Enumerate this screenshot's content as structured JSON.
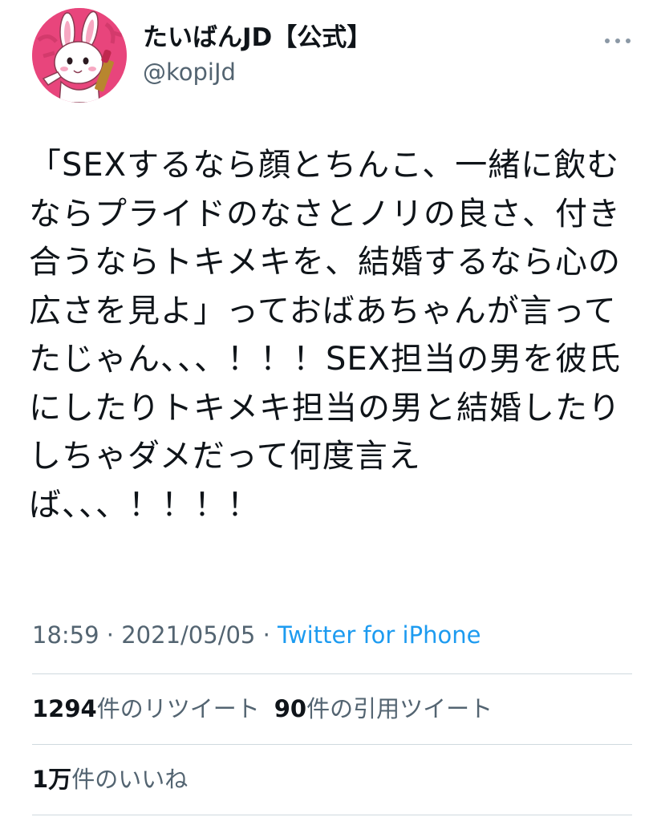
{
  "user": {
    "display_name": "たいばんJD【公式】",
    "handle": "@kopiJd",
    "avatar_icon": "rabbit-mascot-avatar-icon"
  },
  "tweet": {
    "text": "「SEXするなら顔とちんこ、一緒に飲むならプライドのなさとノリの良さ、付き合うならトキメキを、結婚するなら心の広さを見よ」っておばあちゃんが言ってたじゃん、、、！！！SEX担当の男を彼氏にしたりトキメキ担当の男と結婚したりしちゃダメだって何度言えば、、、！！！！",
    "time": "18:59",
    "separator": "·",
    "date": "2021/05/05",
    "source": "Twitter for iPhone"
  },
  "stats": {
    "retweets_count": "1294",
    "retweets_label": "件のリツイート",
    "quotes_count": "90",
    "quotes_label": "件の引用ツイート",
    "likes_count": "1万",
    "likes_label": "件のいいね"
  },
  "colors": {
    "text": "#0f1419",
    "secondary": "#536471",
    "link": "#1d9bf0",
    "avatar_bg": "#e8457c",
    "divider": "#cfd9de"
  }
}
